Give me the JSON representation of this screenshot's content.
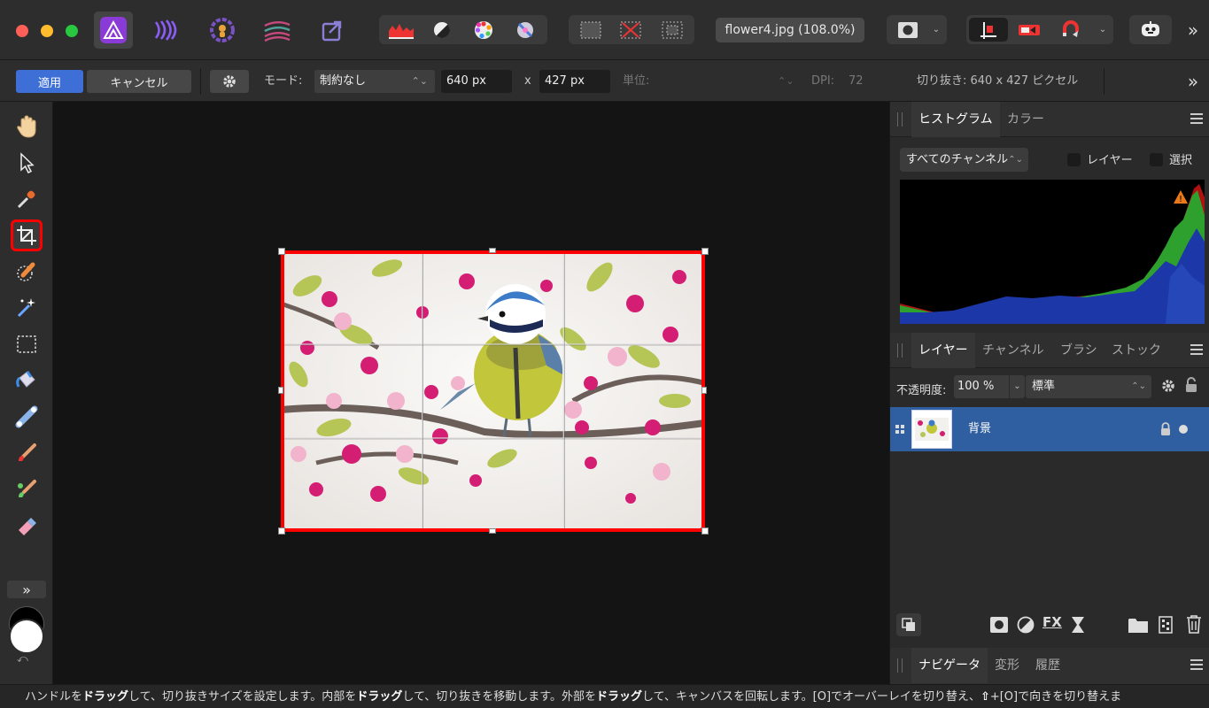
{
  "toolbar": {
    "document_label": "flower4.jpg (108.0%)",
    "more_label": "»"
  },
  "context": {
    "apply_label": "適用",
    "cancel_label": "キャンセル",
    "mode_label": "モード:",
    "mode_value": "制約なし",
    "width_value": "640 px",
    "times_label": "x",
    "height_value": "427 px",
    "unit_label": "単位:",
    "dpi_label": "DPI:",
    "dpi_value": "72",
    "crop_info": "切り抜き: 640 x 427 ピクセル",
    "more_label": "»"
  },
  "tools": {
    "more_label": "»",
    "active_tool": "crop-tool"
  },
  "histogram_panel": {
    "tab_histogram": "ヒストグラム",
    "tab_color": "カラー",
    "channel_select": "すべてのチャンネル",
    "layer_check": "レイヤー",
    "selection_check": "選択"
  },
  "layers_panel": {
    "tab_layers": "レイヤー",
    "tab_channels": "チャンネル",
    "tab_brushes": "ブラシ",
    "tab_stock": "ストック",
    "opacity_label": "不透明度:",
    "opacity_value": "100 %",
    "blend_mode": "標準",
    "layer_name": "背景"
  },
  "navigator_panel": {
    "tab_navigator": "ナビゲータ",
    "tab_transform": "変形",
    "tab_history": "履歴"
  },
  "status": {
    "s1": "ハンドルを",
    "b1": "ドラッグ",
    "s2": "して、切り抜きサイズを設定します。内部を",
    "b2": "ドラッグ",
    "s3": "して、切り抜きを移動します。外部を",
    "b3": "ドラッグ",
    "s4": "して、キャンバスを回転します。[O]でオーバーレイを切り替え、",
    "b4": "⇧",
    "s5": "+[O]で向きを切り替えま"
  },
  "colors": {
    "accent_blue": "#3d6fd6",
    "crop_highlight": "#ff0000",
    "layer_selected": "#2f5fa0"
  }
}
